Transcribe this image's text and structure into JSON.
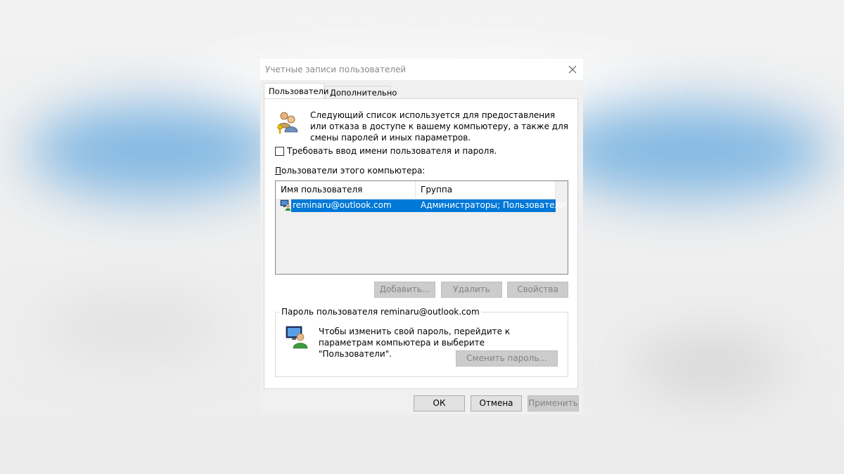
{
  "dialog": {
    "title": "Учетные записи пользователей",
    "close_icon": "close-icon"
  },
  "tabs": [
    {
      "label": "Пользователи",
      "active": true
    },
    {
      "label": "Дополнительно",
      "active": false
    }
  ],
  "info": {
    "icon": "users-keys-icon",
    "text": "Следующий список используется для предоставления или отказа в доступе к вашему компьютеру, а также для смены паролей и иных параметров."
  },
  "require_login": {
    "label": "Требовать ввод имени пользователя и пароля.",
    "checked": false
  },
  "users_label": "Пользователи этого компьютера:",
  "users_table": {
    "columns": [
      "Имя пользователя",
      "Группа"
    ],
    "rows": [
      {
        "name": "reminaru@outlook.com",
        "group": "Администраторы; Пользователи",
        "selected": true,
        "icon": "user-account-icon"
      }
    ]
  },
  "buttons": {
    "add": "Добавить...",
    "remove": "Удалить",
    "properties": "Свойства"
  },
  "password_group": {
    "title": "Пароль пользователя reminaru@outlook.com",
    "icon": "user-monitor-icon",
    "text": "Чтобы изменить свой пароль, перейдите к параметрам компьютера и выберите \"Пользователи\".",
    "change_button": "Сменить пароль..."
  },
  "footer": {
    "ok": "ОК",
    "cancel": "Отмена",
    "apply": "Применить"
  },
  "colors": {
    "selection": "#0078d7",
    "dialog_bg": "#f0f0f0",
    "disabled_text": "#838383"
  }
}
